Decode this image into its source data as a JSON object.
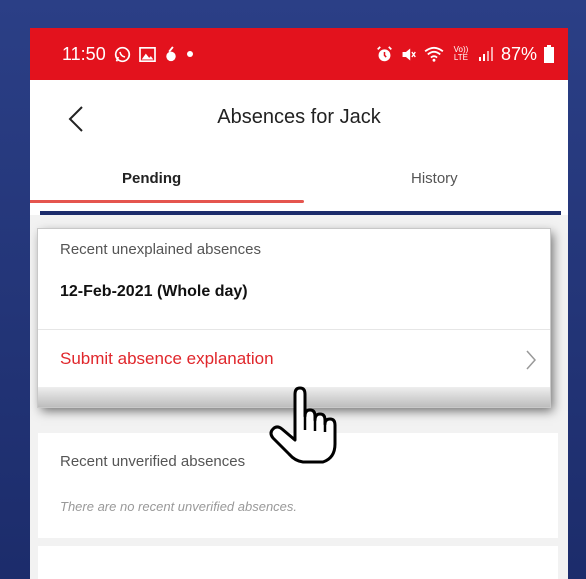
{
  "status_bar": {
    "time": "11:50",
    "battery": "87%",
    "volte_label": "Vo)) LTE",
    "left_icons": [
      "whatsapp-icon",
      "gallery-icon",
      "app-icon",
      "dot-icon"
    ],
    "right_icons": [
      "alarm-icon",
      "mute-icon",
      "wifi-icon",
      "volte-icon",
      "signal-icon",
      "battery-icon"
    ],
    "color": "#e3121d"
  },
  "header": {
    "title": "Absences for Jack",
    "back_icon": "chevron-left-icon"
  },
  "tabs": [
    {
      "label": "Pending",
      "active": true
    },
    {
      "label": "History",
      "active": false
    }
  ],
  "accent_color": "#e5554e",
  "pending": {
    "unexplained": {
      "heading": "Recent unexplained absences",
      "items": [
        {
          "date": "12-Feb-2021 (Whole day)"
        }
      ],
      "action_label": "Submit absence explanation"
    },
    "unverified": {
      "heading": "Recent unverified absences",
      "empty_text": "There are no recent unverified absences."
    }
  },
  "cursor_icon": "hand-pointer-icon"
}
